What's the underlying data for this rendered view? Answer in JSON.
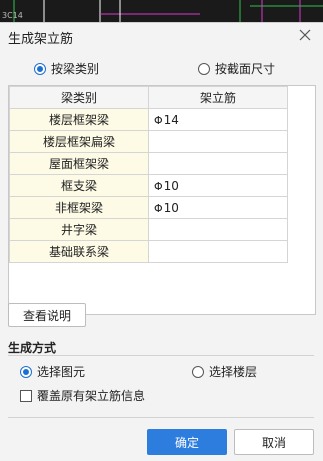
{
  "dialog": {
    "title": "生成架立筋"
  },
  "mode": {
    "by_beam_type_label": "按梁类别",
    "by_section_label": "按截面尺寸",
    "selected": "by_beam_type"
  },
  "table": {
    "headers": [
      "梁类别",
      "架立筋"
    ],
    "rows": [
      {
        "name": "楼层框架梁",
        "rebar": "14"
      },
      {
        "name": "楼层框架扁梁",
        "rebar": ""
      },
      {
        "name": "屋面框架梁",
        "rebar": ""
      },
      {
        "name": "框支梁",
        "rebar": "10"
      },
      {
        "name": "非框架梁",
        "rebar": "10"
      },
      {
        "name": "井字梁",
        "rebar": ""
      },
      {
        "name": "基础联系梁",
        "rebar": ""
      }
    ]
  },
  "help_button": "查看说明",
  "generate": {
    "section_title": "生成方式",
    "select_element_label": "选择图元",
    "select_floor_label": "选择楼层",
    "selected": "select_element",
    "overwrite_label": "覆盖原有架立筋信息",
    "overwrite_checked": false
  },
  "footer": {
    "ok_label": "确定",
    "cancel_label": "取消"
  },
  "background": {
    "cad_text": "3C14"
  },
  "colors": {
    "accent": "#2d7ddf",
    "cad_green": "#2ec24a",
    "cad_magenta": "#d53ad0"
  },
  "icons": {
    "close": "close-icon",
    "rebar": "rebar-grade-symbol"
  }
}
